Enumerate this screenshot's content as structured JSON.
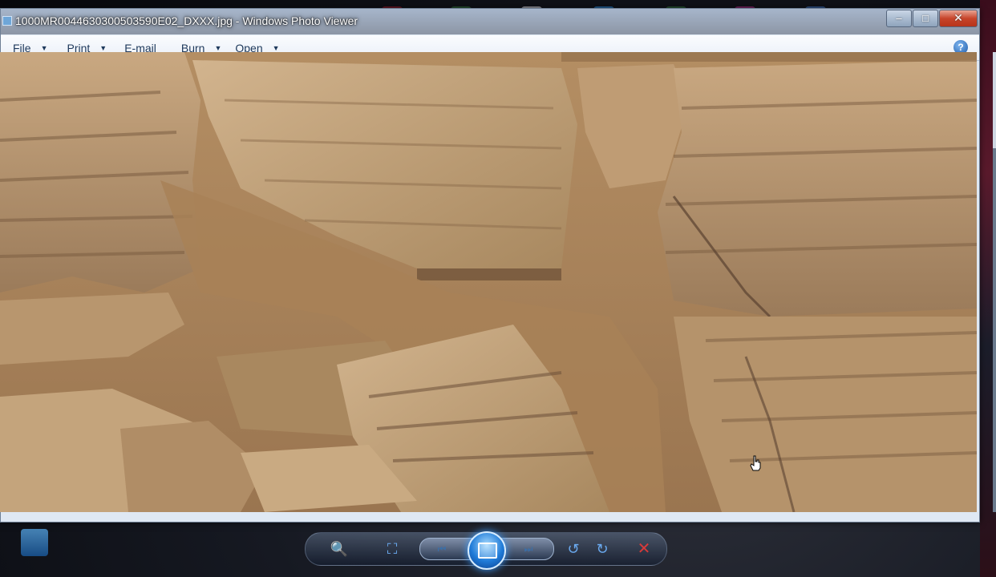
{
  "window": {
    "title": "1000MR0044630300503590E02_DXXX.jpg - Windows Photo Viewer",
    "minimize": "–",
    "maximize": "□",
    "close": "✕"
  },
  "menu": {
    "items": [
      {
        "label": "File",
        "has_dropdown": true
      },
      {
        "label": "Print",
        "has_dropdown": true
      },
      {
        "label": "E-mail",
        "has_dropdown": false
      },
      {
        "label": "Burn",
        "has_dropdown": true
      },
      {
        "label": "Open",
        "has_dropdown": true
      }
    ],
    "help": "?"
  },
  "controls": {
    "zoom": "🔍",
    "actual_size": "⛶",
    "previous": "⏮",
    "next": "⏭",
    "rotate_ccw": "↺",
    "rotate_cw": "↻",
    "delete": "✕"
  },
  "colors": {
    "accent": "#6aa9ee",
    "delete": "#d83a3a",
    "menu_text": "#1e395b"
  }
}
